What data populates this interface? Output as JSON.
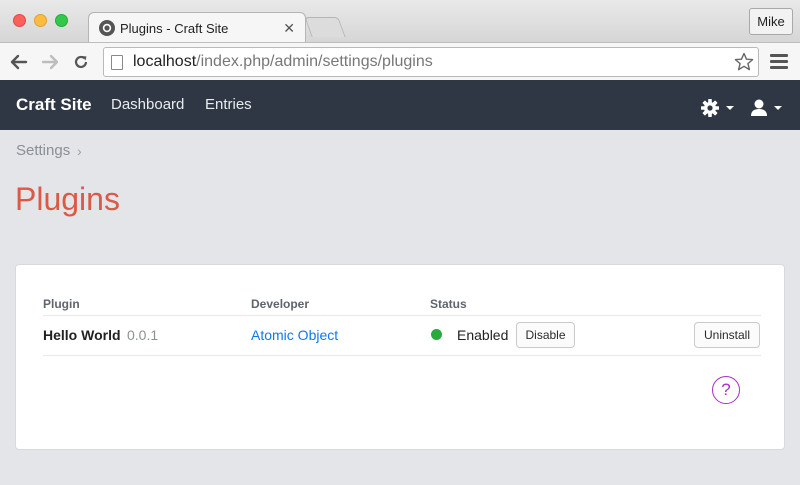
{
  "browser": {
    "tab_title": "Plugins - Craft Site",
    "tab_close": "✕",
    "profile_name": "Mike",
    "url_host": "localhost",
    "url_path": "/index.php/admin/settings/plugins"
  },
  "header": {
    "site_name": "Craft Site",
    "nav": [
      "Dashboard",
      "Entries"
    ]
  },
  "breadcrumb": {
    "items": [
      "Settings"
    ],
    "separator": "›"
  },
  "page": {
    "title": "Plugins"
  },
  "table": {
    "columns": [
      "Plugin",
      "Developer",
      "Status"
    ],
    "rows": [
      {
        "name": "Hello World",
        "version": "0.0.1",
        "developer": "Atomic Object",
        "status": "Enabled",
        "status_color": "#27ab3f",
        "toggle_label": "Disable",
        "uninstall_label": "Uninstall"
      }
    ]
  },
  "help": {
    "glyph": "?"
  },
  "colors": {
    "header_bg": "#2e3743",
    "title": "#da5a47",
    "link": "#0d78f2",
    "help_accent": "#a433c6"
  }
}
